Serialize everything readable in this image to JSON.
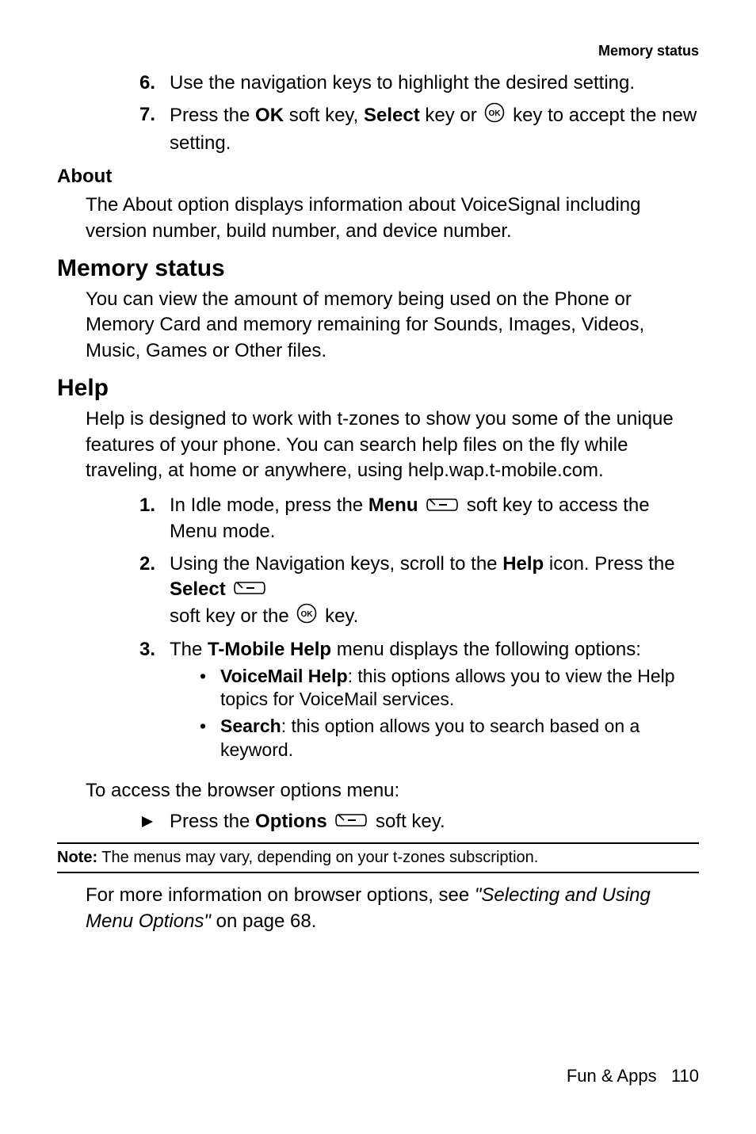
{
  "header": {
    "right_label": "Memory status"
  },
  "steps_top": [
    {
      "num": "6.",
      "text_before": "Use the navigation keys to highlight the desired setting."
    },
    {
      "num": "7.",
      "text_a": "Press the ",
      "bold_a": "OK",
      "text_b": " soft key, ",
      "bold_b": "Select",
      "text_c": " key or ",
      "text_d": " key to accept the new setting."
    }
  ],
  "about": {
    "heading": "About",
    "body": "The About option displays information about VoiceSignal including version number, build number, and device number."
  },
  "memory": {
    "heading": "Memory status",
    "body": "You can view the amount of memory being used on the Phone or Memory Card and memory remaining for Sounds, Images, Videos, Music, Games or Other files."
  },
  "help": {
    "heading": "Help",
    "intro": "Help is designed to work with t-zones to show you some of the unique features of your phone. You can search help files on the fly while traveling, at home or anywhere, using help.wap.t-mobile.com.",
    "steps": [
      {
        "num": "1.",
        "pre": "In Idle mode, press the ",
        "bold": "Menu",
        "post": " soft key to access the Menu mode."
      },
      {
        "num": "2.",
        "pre": "Using the Navigation keys, scroll to the ",
        "bold1": "Help",
        "mid": " icon. Press the ",
        "bold2": "Select",
        "line2_pre": "soft key or the ",
        "line2_post": " key."
      },
      {
        "num": "3.",
        "pre": "The ",
        "bold": "T-Mobile Help",
        "post": " menu displays the following options:"
      }
    ],
    "bullets": [
      {
        "bold": "VoiceMail Help",
        "rest": ": this options allows you to view the Help topics for VoiceMail services."
      },
      {
        "bold": "Search",
        "rest": ": this option allows you to search based on a keyword."
      }
    ],
    "access_line": "To access the browser options menu:",
    "action_pre": "Press the ",
    "action_bold": "Options",
    "action_post": " soft key."
  },
  "note": {
    "label": "Note:",
    "text": " The menus may vary, depending on your t-zones subscription."
  },
  "closing": {
    "pre": "For more information on browser options, see ",
    "italic": "\"Selecting and Using Menu Options\"",
    "post": " on page 68."
  },
  "footer": {
    "section": "Fun & Apps",
    "page": "110"
  }
}
